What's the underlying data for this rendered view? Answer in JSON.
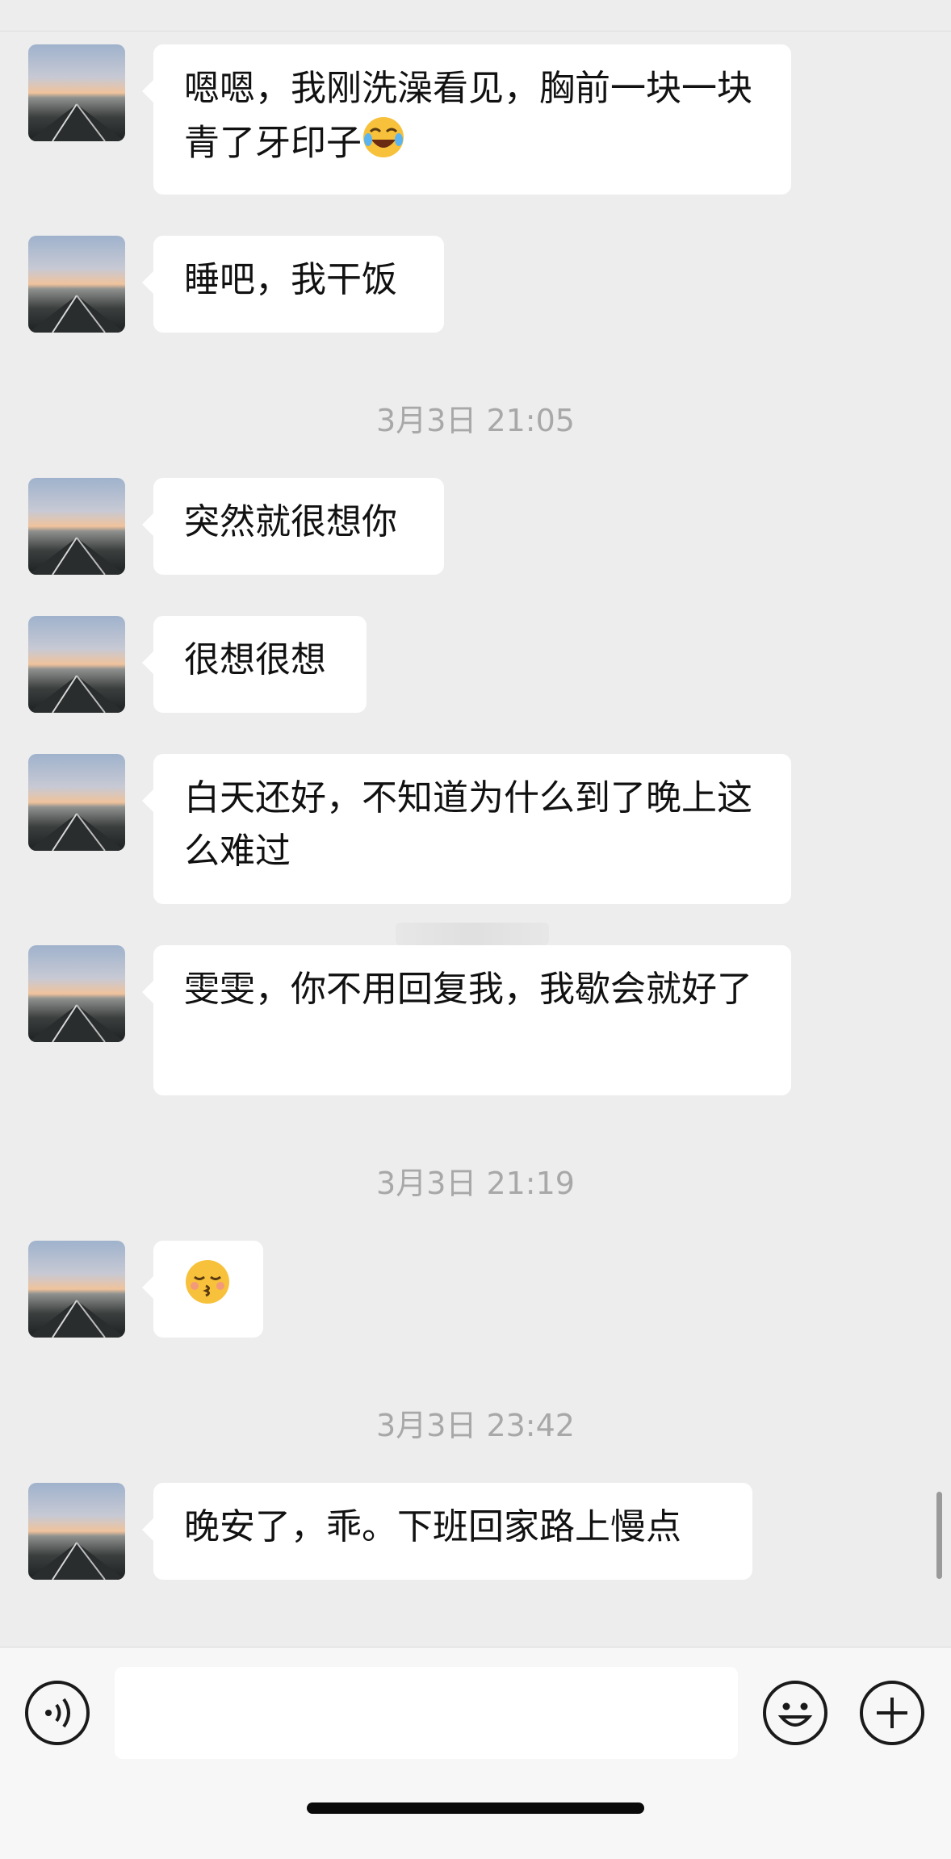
{
  "colors": {
    "background": "#ededed",
    "bubble": "#ffffff",
    "timestamp": "#a8a8a8",
    "text": "#111111"
  },
  "contact": {
    "avatar_icon": "sunset-road-avatar"
  },
  "messages": [
    {
      "text": "嗯嗯，我刚洗澡看见，胸前一块一块青了牙印子",
      "trailing_emoji": "tears-of-joy-emoji"
    },
    {
      "text": "睡吧，我干饭"
    },
    {
      "text": "突然就很想你"
    },
    {
      "text": "很想很想"
    },
    {
      "text": "白天还好，不知道为什么到了晚上这么难过"
    },
    {
      "text": "雯雯，你不用回复我，我歇会就好了"
    },
    {
      "emoji": "kissing-face-emoji"
    },
    {
      "text": "晚安了，乖。下班回家路上慢点"
    }
  ],
  "timestamps": [
    "3月3日 21:05",
    "3月3日 21:19",
    "3月3日 23:42"
  ],
  "input_bar": {
    "voice_icon": "voice-icon",
    "emoji_icon": "smiley-icon",
    "add_icon": "plus-icon",
    "value": "",
    "placeholder": ""
  }
}
